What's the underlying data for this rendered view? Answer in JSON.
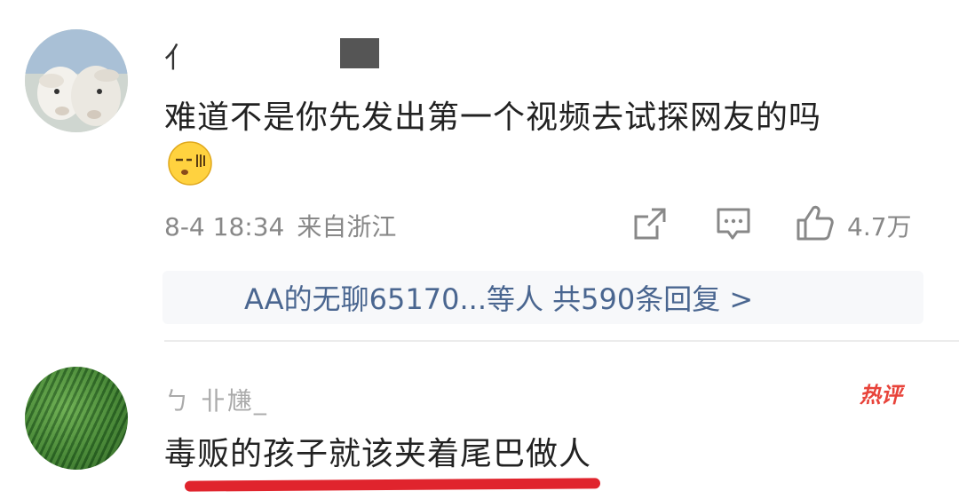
{
  "comment1": {
    "username": "亻",
    "text": "难道不是你先发出第一个视频去试探网友的吗",
    "emoji": "yawn-emoji",
    "date": "8-4 18:34",
    "location": "来自浙江",
    "likes": "4.7万",
    "replies_summary": "AA的无聊65170...等人  共590条回复 >"
  },
  "comment2": {
    "username": "ㄅ 卝尲_",
    "badge": "热评",
    "text": "毒贩的孩子就该夹着尾巴做人"
  },
  "colors": {
    "link": "#4a6690",
    "hot": "#e8433a",
    "underline": "#e0242d",
    "meta": "#888888"
  }
}
